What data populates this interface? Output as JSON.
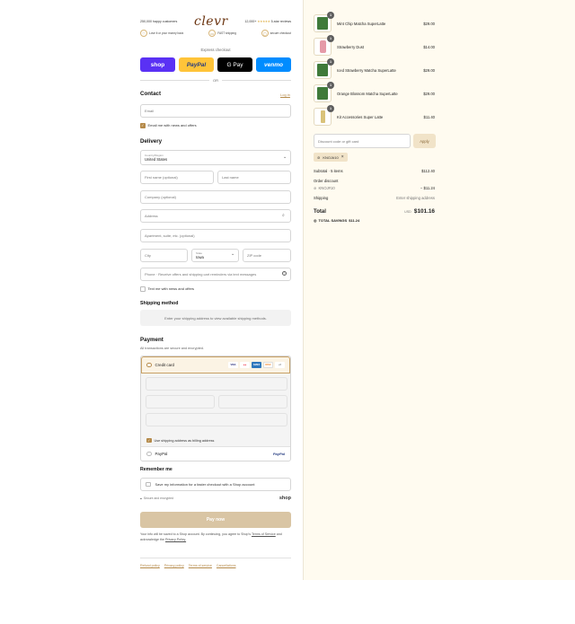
{
  "header": {
    "happy_customers": "250,000 happy customers",
    "logo": "clevr",
    "reviews_count": "12,000+",
    "stars": "★★★★★",
    "reviews_label": "5-star reviews",
    "perks": [
      {
        "icon": "heart-icon",
        "label": "Love it or your money back"
      },
      {
        "icon": "truck-icon",
        "label": "FAST shipping"
      },
      {
        "icon": "lock-icon",
        "label": "secure checkout"
      }
    ]
  },
  "express": {
    "label": "Express checkout",
    "buttons": [
      "shop",
      "PayPal",
      "G Pay",
      "venmo"
    ],
    "or": "OR"
  },
  "contact": {
    "heading": "Contact",
    "login": "Log in",
    "email_placeholder": "Email",
    "newsletter": "Email me with news and offers"
  },
  "delivery": {
    "heading": "Delivery",
    "country_label": "Country/Region",
    "country_value": "United States",
    "first_name": "First name (optional)",
    "last_name": "Last name",
    "company": "Company (optional)",
    "address": "Address",
    "apartment": "Apartment, suite, etc. (optional)",
    "city": "City",
    "state_label": "State",
    "state_value": "Iowa",
    "zip": "ZIP code",
    "phone": "Phone · Receive offers and shipping cart reminders via text messages",
    "text_me": "Text me with news and offers"
  },
  "shipping": {
    "heading": "Shipping method",
    "notice": "Enter your shipping address to view available shipping methods."
  },
  "payment": {
    "heading": "Payment",
    "subtitle": "All transactions are secure and encrypted.",
    "credit_card": "Credit card",
    "cards": [
      "VISA",
      "MC",
      "AMEX",
      "DISC",
      "+6"
    ],
    "billing_same": "Use shipping address as billing address",
    "paypal": "PayPal",
    "paypal_logo": "PayPal"
  },
  "remember": {
    "heading": "Remember me",
    "save_info": "Save my information for a faster checkout with a Shop account",
    "secure": "Secure and encrypted",
    "shop": "shop"
  },
  "pay_now": "Pay now",
  "legal": {
    "text": "Your info will be saved to a Shop account. By continuing, you agree to Shop's",
    "terms": "Terms of Service",
    "and": "and acknowledge the",
    "privacy": "Privacy Policy."
  },
  "footer_links": [
    "Refund policy",
    "Privacy policy",
    "Terms of service",
    "Cancellations"
  ],
  "cart": {
    "items": [
      {
        "qty": "1",
        "name": "Mint Chip Matcha SuperLatte",
        "price": "$29.00",
        "color": "#3f7a3a"
      },
      {
        "qty": "1",
        "name": "Strawberry Dust",
        "price": "$14.00",
        "color": "#e59aa8"
      },
      {
        "qty": "1",
        "name": "Iced Strawberry Matcha SuperLatte",
        "price": "$29.00",
        "color": "#3f7a3a"
      },
      {
        "qty": "1",
        "name": "Orange Blossom Matcha SuperLatte",
        "price": "$29.00",
        "color": "#3f7a3a"
      },
      {
        "qty": "1",
        "name": "Kit Accessories Super Latte",
        "price": "$11.40",
        "color": "#d9c27a"
      }
    ],
    "discount_placeholder": "Discount code or gift card",
    "apply": "Apply",
    "tag": "KNOJ#10",
    "subtotal_label": "Subtotal · 5 items",
    "subtotal_value": "$112.40",
    "order_discount_label": "Order discount",
    "discount_code": "KNOJ#10",
    "discount_value": "− $11.24",
    "shipping_label": "Shipping",
    "shipping_value": "Enter shipping address",
    "total_label": "Total",
    "currency": "USD",
    "total_value": "$101.16",
    "savings_label": "TOTAL SAVINGS",
    "savings_value": "$11.24"
  }
}
